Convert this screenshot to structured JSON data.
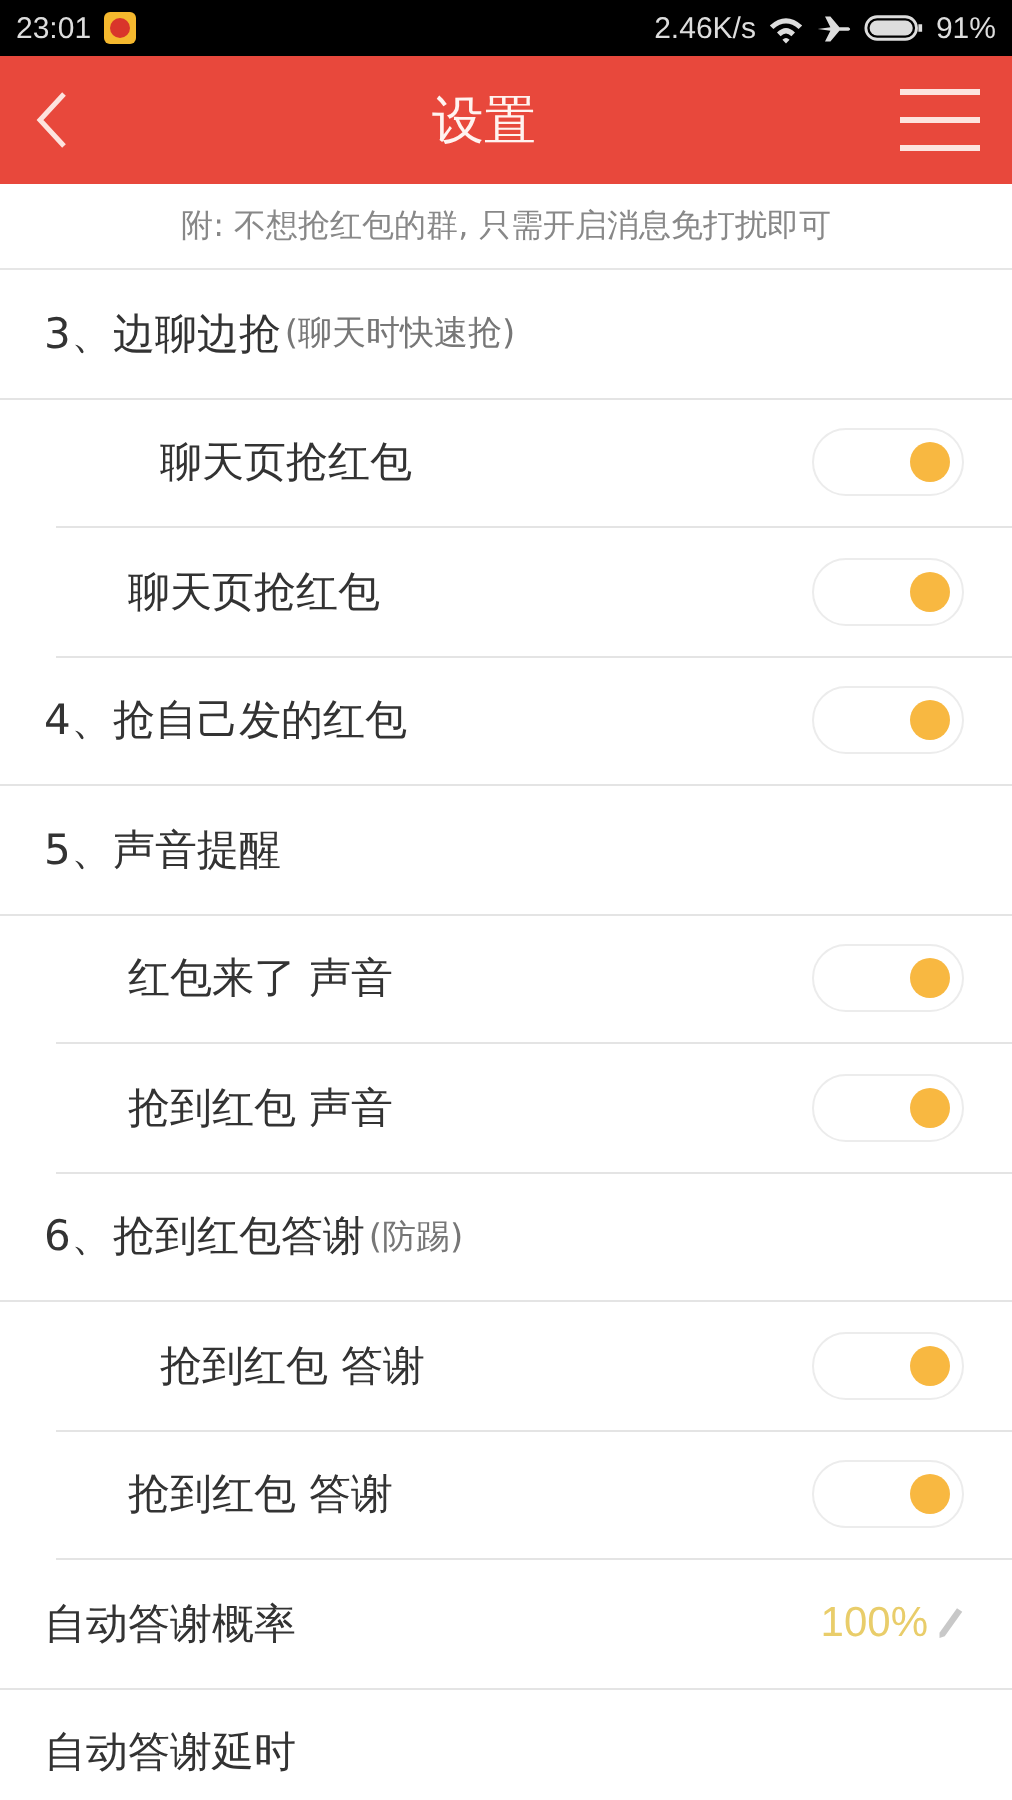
{
  "status_bar": {
    "time": "23:01",
    "speed": "2.46K/s",
    "battery": "91%"
  },
  "header": {
    "title": "设置"
  },
  "notice": "附: 不想抢红包的群, 只需开启消息免打扰即可",
  "settings": [
    {
      "kind": "section",
      "label": "3、边聊边抢",
      "note": "(聊天时快速抢)",
      "children": [
        {
          "kind": "subtoggle",
          "label": "聊天页抢红包",
          "on": true
        },
        {
          "kind": "toggle",
          "label": "聊天页抢红包",
          "on": true
        }
      ]
    },
    {
      "kind": "section",
      "label": "4、抢自己发的红包",
      "on": true
    },
    {
      "kind": "section",
      "label": "5、声音提醒",
      "children": [
        {
          "kind": "toggle",
          "label": "红包来了 声音",
          "on": true
        },
        {
          "kind": "toggle",
          "label": "抢到红包 声音",
          "on": true
        }
      ]
    },
    {
      "kind": "section",
      "label": "6、抢到红包答谢",
      "note": "(防踢)",
      "children": [
        {
          "kind": "subtoggle",
          "label": "抢到红包 答谢",
          "on": true
        },
        {
          "kind": "toggle",
          "label": "抢到红包 答谢",
          "on": true
        }
      ]
    },
    {
      "kind": "value",
      "label": "自动答谢概率",
      "value": "100%"
    },
    {
      "kind": "value",
      "label": "自动答谢延时"
    }
  ]
}
